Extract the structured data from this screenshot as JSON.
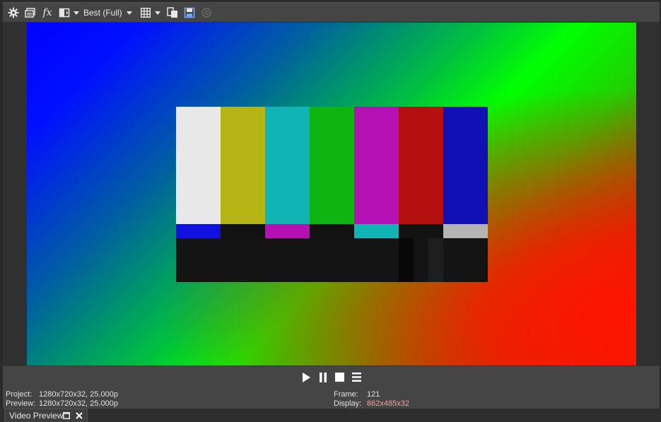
{
  "toolbar": {
    "icons": [
      "settings-icon",
      "split-screen-icon",
      "fx-icon",
      "preview-mode-icon",
      "grid-icon",
      "copy-snapshot-icon",
      "save-snapshot-icon",
      "external-monitor-icon"
    ],
    "quality_label": "Best (Full)",
    "fx_label": "fx"
  },
  "frame": {
    "bars_top": [
      "#e8e8e8",
      "#b4b414",
      "#10b4b4",
      "#10b410",
      "#b410b4",
      "#b41010",
      "#1010b4"
    ],
    "bars_mid": [
      "#1010e0",
      "#121212",
      "#b410b4",
      "#121212",
      "#10b4b4",
      "#121212",
      "#b4b4b4"
    ]
  },
  "transport": {
    "icons": [
      "play-icon",
      "pause-icon",
      "stop-icon",
      "menu-icon"
    ]
  },
  "status": {
    "project_label": "Project:",
    "project_value": "1280x720x32, 25.000p",
    "preview_label": "Preview:",
    "preview_value": "1280x720x32, 25.000p",
    "frame_label": "Frame:",
    "frame_value": "121",
    "display_label": "Display:",
    "display_value": "862x485x32"
  },
  "tab": {
    "label": "Video Preview"
  }
}
